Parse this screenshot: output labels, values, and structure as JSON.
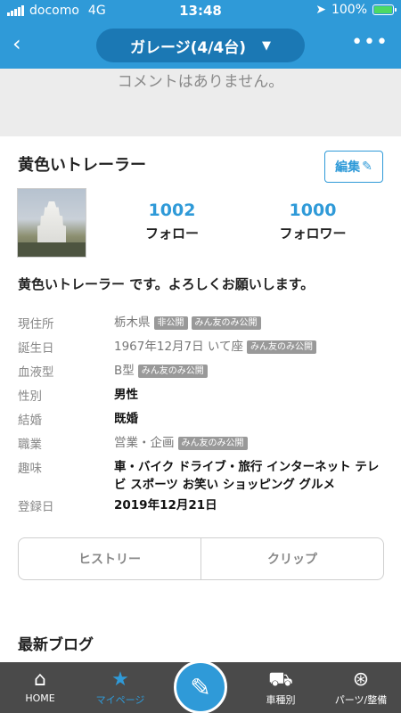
{
  "status_bar": {
    "carrier": "docomo",
    "network": "4G",
    "time": "13:48",
    "battery": "100%",
    "battery_fill": 1.0
  },
  "nav": {
    "back_icon": "chevron-left-icon",
    "title": "ガレージ(4/4台)",
    "more_icon": "more-icon"
  },
  "comment": {
    "empty_text": "コメントはありません。"
  },
  "profile": {
    "name": "黄色いトレーラー",
    "edit_label": "編集",
    "follow_count": "1002",
    "follow_label": "フォロー",
    "follower_count": "1000",
    "follower_label": "フォロワー",
    "intro": "黄色いトレーラー です。よろしくお願いします。",
    "details": [
      {
        "key": "現住所",
        "value": "栃木県",
        "tags": [
          "非公開",
          "みん友のみ公開"
        ],
        "style": "gray"
      },
      {
        "key": "誕生日",
        "value": "1967年12月7日 いて座",
        "tags": [
          "みん友のみ公開"
        ],
        "style": "gray"
      },
      {
        "key": "血液型",
        "value": "B型",
        "tags": [
          "みん友のみ公開"
        ],
        "style": "gray"
      },
      {
        "key": "性別",
        "value": "男性",
        "tags": [],
        "style": "dark"
      },
      {
        "key": "結婚",
        "value": "既婚",
        "tags": [],
        "style": "dark"
      },
      {
        "key": "職業",
        "value": "営業・企画",
        "tags": [
          "みん友のみ公開"
        ],
        "style": "gray"
      },
      {
        "key": "趣味",
        "value": "車・バイク ドライブ・旅行 インターネット テレビ スポーツ お笑い ショッピング グルメ",
        "tags": [],
        "style": "dark"
      },
      {
        "key": "登録日",
        "value": "2019年12月21日",
        "tags": [],
        "style": "dark"
      }
    ]
  },
  "tabs": {
    "history": "ヒストリー",
    "clip": "クリップ"
  },
  "blog": {
    "section_title": "最新ブログ"
  },
  "bottom_nav": {
    "home": "HOME",
    "mypage": "マイページ",
    "car_type": "車種別",
    "parts": "パーツ/整備"
  },
  "colors": {
    "brand": "#2f9ad8",
    "bottom_bar": "#4a4a4a"
  }
}
